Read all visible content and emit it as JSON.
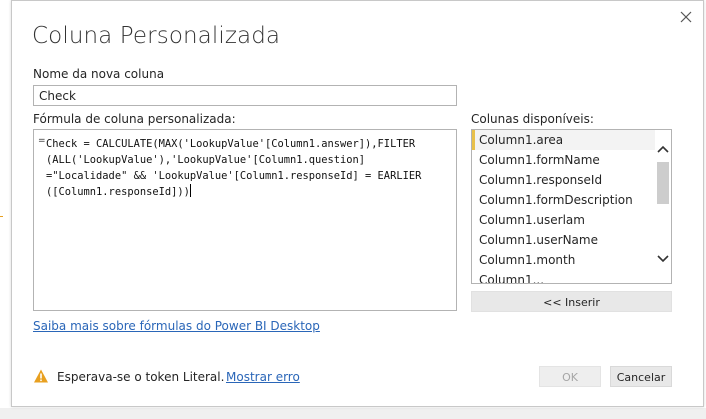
{
  "dialog": {
    "title": "Coluna Personalizada",
    "close_icon": "close-icon"
  },
  "new_column": {
    "label": "Nome da nova coluna",
    "value": "Check"
  },
  "formula": {
    "label": "Fórmula de coluna personalizada:",
    "equals_sign": "=",
    "text": "Check = CALCULATE(MAX('LookupValue'[Column1.answer]),FILTER\n(ALL('LookupValue'),'LookupValue'[Column1.question]\n=\"Localidade\" && 'LookupValue'[Column1.responseId] = EARLIER\n([Column1.responseId]))"
  },
  "available_columns": {
    "label": "Colunas disponíveis:",
    "items": [
      "Column1.area",
      "Column1.formName",
      "Column1.responseId",
      "Column1.formDescription",
      "Column1.userlam",
      "Column1.userName",
      "Column1.month",
      "Column1..."
    ],
    "selected_index": 0
  },
  "buttons": {
    "insert": "<< Inserir",
    "ok": "OK",
    "cancel": "Cancelar"
  },
  "links": {
    "learn_more": "Saiba mais sobre fórmulas do Power BI Desktop",
    "show_error": "Mostrar erro"
  },
  "status": {
    "error_message": "Esperava-se o token Literal.",
    "icon": "warning-icon"
  },
  "colors": {
    "accent_selected": "#e8c04a",
    "link": "#2a66b8",
    "warning": "#e8a020"
  }
}
